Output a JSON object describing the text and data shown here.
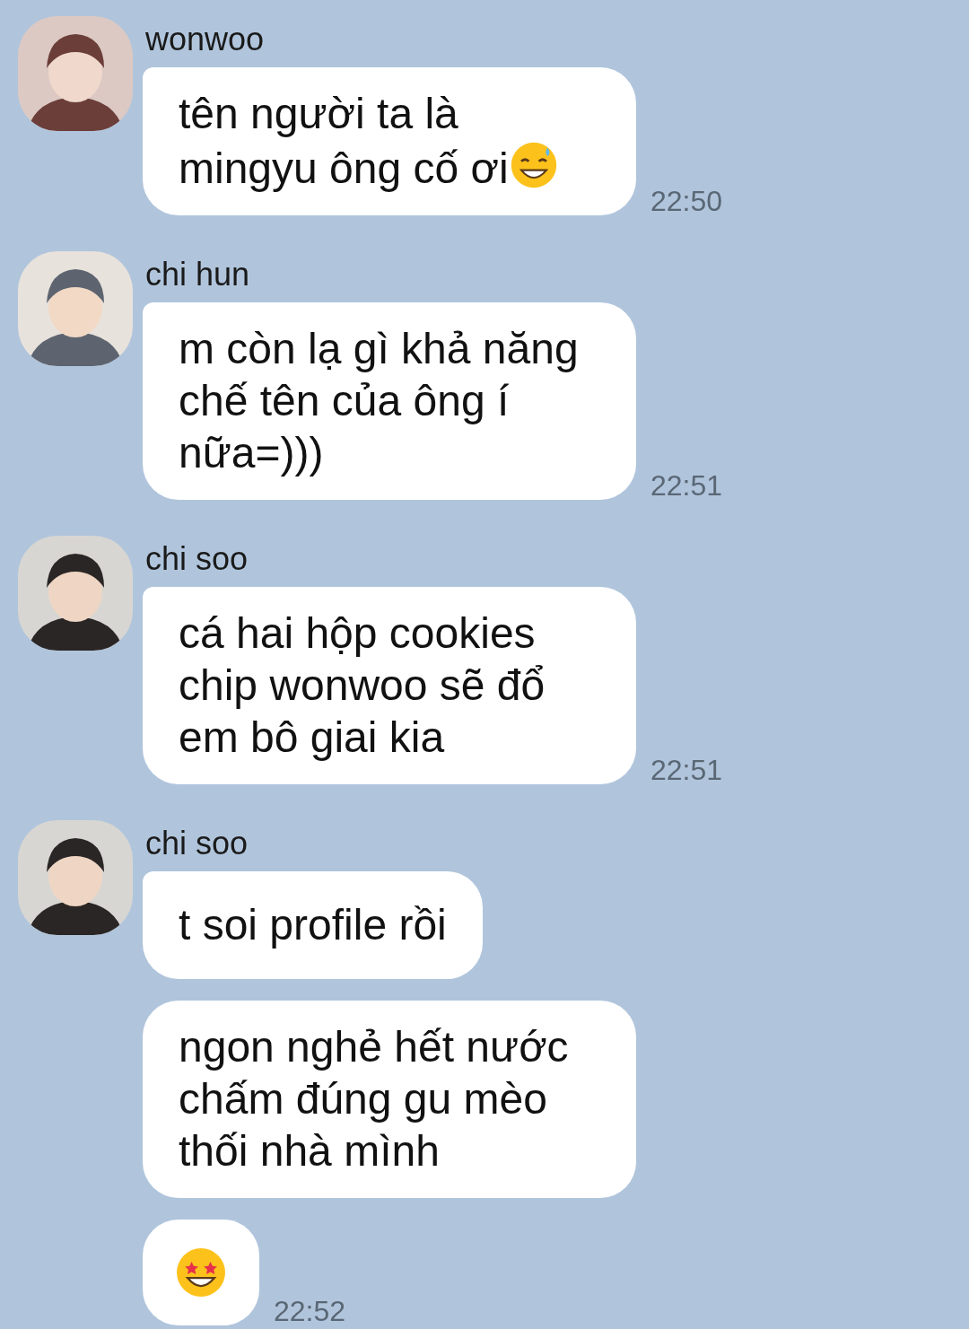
{
  "groups": [
    {
      "sender": "wonwoo",
      "avatar": {
        "kind": "picture"
      },
      "messages": [
        {
          "kind": "text",
          "text": "tên người ta là mingyu ông cố ơi",
          "emoji_after": true,
          "time": "22:50"
        }
      ]
    },
    {
      "sender": "chi hun",
      "avatar": {
        "kind": "picture"
      },
      "messages": [
        {
          "kind": "text",
          "text": "m còn lạ gì khả năng chế tên của ông í nữa=)))",
          "emoji_after": false,
          "time": "22:51"
        }
      ]
    },
    {
      "sender": "chi soo",
      "avatar": {
        "kind": "picture"
      },
      "messages": [
        {
          "kind": "text",
          "text": "cá hai hộp cookies chip wonwoo sẽ đổ em bô giai kia",
          "emoji_after": false,
          "time": "22:51"
        }
      ]
    },
    {
      "sender": "chi soo",
      "avatar": {
        "kind": "picture"
      },
      "messages": [
        {
          "kind": "text",
          "text": "t soi profile rồi",
          "emoji_after": false
        },
        {
          "kind": "text",
          "text": "ngon nghẻ hết nước chấm đúng gu mèo thối nhà mình",
          "emoji_after": false
        },
        {
          "kind": "emoji",
          "time": "22:52"
        }
      ]
    }
  ]
}
